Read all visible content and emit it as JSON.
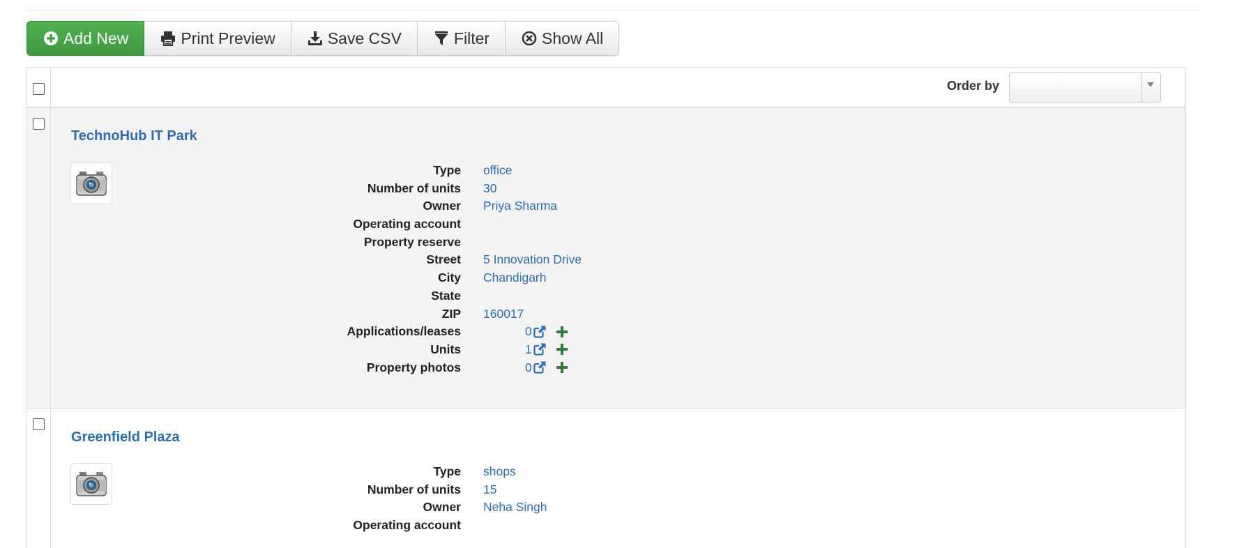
{
  "toolbar": {
    "add_new": "Add New",
    "print_preview": "Print Preview",
    "save_csv": "Save CSV",
    "filter": "Filter",
    "show_all": "Show All"
  },
  "header": {
    "order_by_label": "Order by",
    "order_by_value": ""
  },
  "labels": {
    "type": "Type",
    "units_count": "Number of units",
    "owner": "Owner",
    "operating_account": "Operating account",
    "property_reserve": "Property reserve",
    "street": "Street",
    "city": "City",
    "state": "State",
    "zip": "ZIP",
    "applications": "Applications/leases",
    "units": "Units",
    "photos": "Property photos"
  },
  "records": [
    {
      "title": "TechnoHub IT Park",
      "type": "office",
      "units_count": "30",
      "owner": "Priya Sharma",
      "operating_account": "",
      "property_reserve": "",
      "street": "5 Innovation Drive",
      "city": "Chandigarh",
      "state": "",
      "zip": "160017",
      "applications": "0",
      "units": "1",
      "photos": "0"
    },
    {
      "title": "Greenfield Plaza",
      "type": "shops",
      "units_count": "15",
      "owner": "Neha Singh"
    }
  ],
  "icons": {
    "add": "plus-circle-icon",
    "print": "printer-icon",
    "save": "download-icon",
    "filter": "funnel-icon",
    "show_all": "times-circle-icon",
    "photo": "camera-icon",
    "external": "external-link-icon",
    "plus": "plus-icon"
  },
  "colors": {
    "accent_green": "#449d44",
    "link_blue": "#2a6ebb",
    "plus_green": "#2e7d32"
  }
}
